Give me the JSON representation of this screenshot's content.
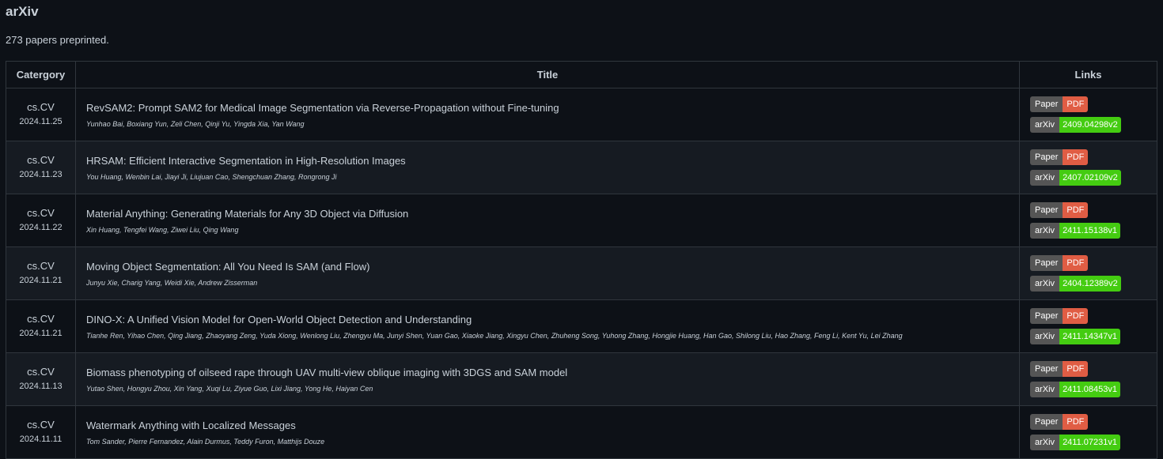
{
  "page": {
    "title": "arXiv",
    "count_text": "273 papers preprinted."
  },
  "table": {
    "headers": {
      "category": "Catergory",
      "title": "Title",
      "links": "Links"
    },
    "badges": {
      "paper_label": "Paper",
      "pdf_label": "PDF",
      "arxiv_label": "arXiv"
    },
    "rows": [
      {
        "category": "cs.CV",
        "date": "2024.11.25",
        "title": "RevSAM2: Prompt SAM2 for Medical Image Segmentation via Reverse-Propagation without Fine-tuning",
        "authors": "Yunhao Bai, Boxiang Yun, Zeli Chen, Qinji Yu, Yingda Xia, Yan Wang",
        "arxiv_id": "2409.04298v2"
      },
      {
        "category": "cs.CV",
        "date": "2024.11.23",
        "title": "HRSAM: Efficient Interactive Segmentation in High-Resolution Images",
        "authors": "You Huang, Wenbin Lai, Jiayi Ji, Liujuan Cao, Shengchuan Zhang, Rongrong Ji",
        "arxiv_id": "2407.02109v2"
      },
      {
        "category": "cs.CV",
        "date": "2024.11.22",
        "title": "Material Anything: Generating Materials for Any 3D Object via Diffusion",
        "authors": "Xin Huang, Tengfei Wang, Ziwei Liu, Qing Wang",
        "arxiv_id": "2411.15138v1"
      },
      {
        "category": "cs.CV",
        "date": "2024.11.21",
        "title": "Moving Object Segmentation: All You Need Is SAM (and Flow)",
        "authors": "Junyu Xie, Charig Yang, Weidi Xie, Andrew Zisserman",
        "arxiv_id": "2404.12389v2"
      },
      {
        "category": "cs.CV",
        "date": "2024.11.21",
        "title": "DINO-X: A Unified Vision Model for Open-World Object Detection and Understanding",
        "authors": "Tianhe Ren, Yihao Chen, Qing Jiang, Zhaoyang Zeng, Yuda Xiong, Wenlong Liu, Zhengyu Ma, Junyi Shen, Yuan Gao, Xiaoke Jiang, Xingyu Chen, Zhuheng Song, Yuhong Zhang, Hongjie Huang, Han Gao, Shilong Liu, Hao Zhang, Feng Li, Kent Yu, Lei Zhang",
        "arxiv_id": "2411.14347v1"
      },
      {
        "category": "cs.CV",
        "date": "2024.11.13",
        "title": "Biomass phenotyping of oilseed rape through UAV multi-view oblique imaging with 3DGS and SAM model",
        "authors": "Yutao Shen, Hongyu Zhou, Xin Yang, Xuqi Lu, Ziyue Guo, Lixi Jiang, Yong He, Haiyan Cen",
        "arxiv_id": "2411.08453v1"
      },
      {
        "category": "cs.CV",
        "date": "2024.11.11",
        "title": "Watermark Anything with Localized Messages",
        "authors": "Tom Sander, Pierre Fernandez, Alain Durmus, Teddy Furon, Matthijs Douze",
        "arxiv_id": "2411.07231v1"
      }
    ]
  }
}
